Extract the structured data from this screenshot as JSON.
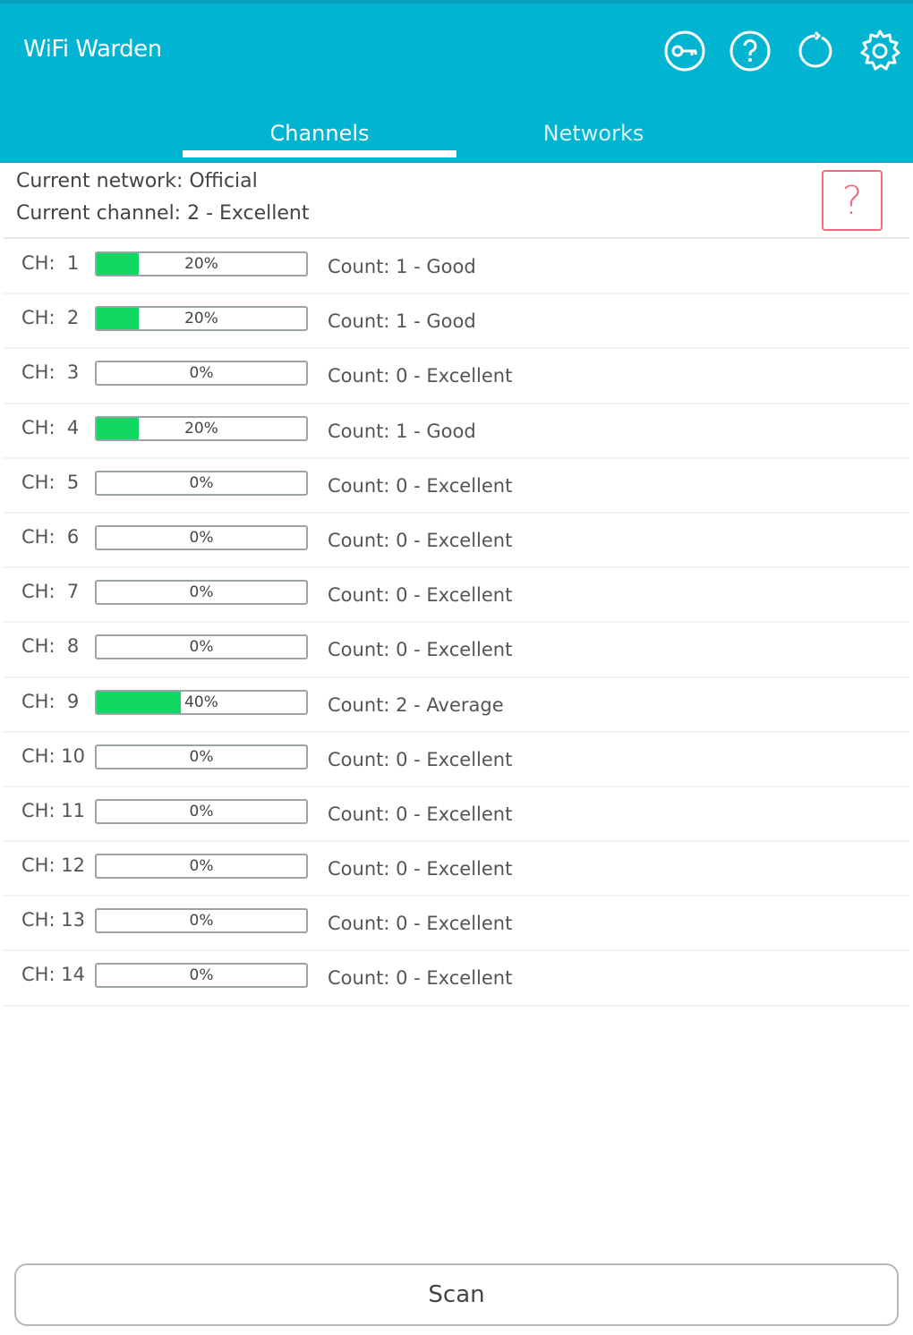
{
  "app": {
    "title": "WiFi Warden",
    "accent_color": "#00b4d2",
    "toolbar_icons": [
      "key-icon",
      "help-icon",
      "refresh-icon",
      "settings-icon"
    ]
  },
  "tabs": [
    {
      "label": "Channels",
      "active": true
    },
    {
      "label": "Networks",
      "active": false
    }
  ],
  "info": {
    "current_network": "Current network: Official",
    "current_channel": "Current channel: 2 - Excellent",
    "help_glyph": "?"
  },
  "channels": [
    {
      "label": "CH:  1",
      "percent": 20,
      "percent_text": "20%",
      "status": "Count: 1 - Good"
    },
    {
      "label": "CH:  2",
      "percent": 20,
      "percent_text": "20%",
      "status": "Count: 1 - Good"
    },
    {
      "label": "CH:  3",
      "percent": 0,
      "percent_text": "0%",
      "status": "Count: 0 - Excellent"
    },
    {
      "label": "CH:  4",
      "percent": 20,
      "percent_text": "20%",
      "status": "Count: 1 - Good"
    },
    {
      "label": "CH:  5",
      "percent": 0,
      "percent_text": "0%",
      "status": "Count: 0 - Excellent"
    },
    {
      "label": "CH:  6",
      "percent": 0,
      "percent_text": "0%",
      "status": "Count: 0 - Excellent"
    },
    {
      "label": "CH:  7",
      "percent": 0,
      "percent_text": "0%",
      "status": "Count: 0 - Excellent"
    },
    {
      "label": "CH:  8",
      "percent": 0,
      "percent_text": "0%",
      "status": "Count: 0 - Excellent"
    },
    {
      "label": "CH:  9",
      "percent": 40,
      "percent_text": "40%",
      "status": "Count: 2 - Average"
    },
    {
      "label": "CH: 10",
      "percent": 0,
      "percent_text": "0%",
      "status": "Count: 0 - Excellent"
    },
    {
      "label": "CH: 11",
      "percent": 0,
      "percent_text": "0%",
      "status": "Count: 0 - Excellent"
    },
    {
      "label": "CH: 12",
      "percent": 0,
      "percent_text": "0%",
      "status": "Count: 0 - Excellent"
    },
    {
      "label": "CH: 13",
      "percent": 0,
      "percent_text": "0%",
      "status": "Count: 0 - Excellent"
    },
    {
      "label": "CH: 14",
      "percent": 0,
      "percent_text": "0%",
      "status": "Count: 0 - Excellent"
    }
  ],
  "bar_fill_color": "#10d860",
  "actions": {
    "scan_label": "Scan"
  }
}
